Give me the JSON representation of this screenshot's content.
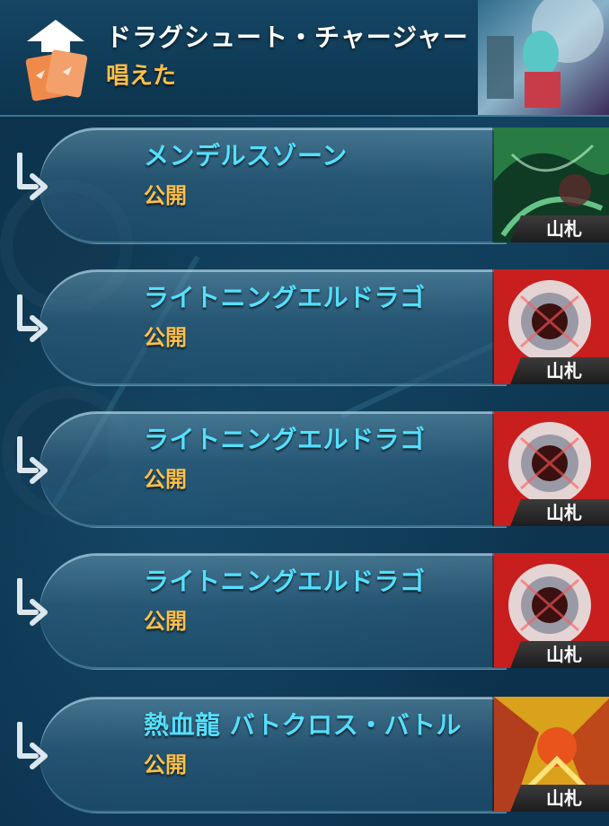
{
  "header": {
    "title": "ドラグシュート・チャージャー",
    "action": "唱えた",
    "icon": "cast-spell-cards-icon",
    "card_art": "card-art-dragshoot-charger"
  },
  "rows": [
    {
      "name": "メンデルスゾーン",
      "action": "公開",
      "zone": "山札",
      "icon": "reveal-arrow-icon",
      "card_art": "card-art-mendelssohn",
      "card_color": "#1f6b3a"
    },
    {
      "name": "ライトニングエルドラゴ",
      "action": "公開",
      "zone": "山札",
      "icon": "reveal-arrow-icon",
      "card_art": "card-art-lightning-eldrago",
      "card_color": "#c81e1e"
    },
    {
      "name": "ライトニングエルドラゴ",
      "action": "公開",
      "zone": "山札",
      "icon": "reveal-arrow-icon",
      "card_art": "card-art-lightning-eldrago",
      "card_color": "#c81e1e"
    },
    {
      "name": "ライトニングエルドラゴ",
      "action": "公開",
      "zone": "山札",
      "icon": "reveal-arrow-icon",
      "card_art": "card-art-lightning-eldrago",
      "card_color": "#c81e1e"
    },
    {
      "name": "熱血龍 バトクロス・バトル",
      "action": "公開",
      "zone": "山札",
      "icon": "reveal-arrow-icon",
      "card_art": "card-art-batcross-battle",
      "card_color": "#d9a21a"
    }
  ],
  "colors": {
    "card_name": "#54e0ff",
    "action_text": "#ffc04a",
    "title_text": "#ffffff"
  }
}
